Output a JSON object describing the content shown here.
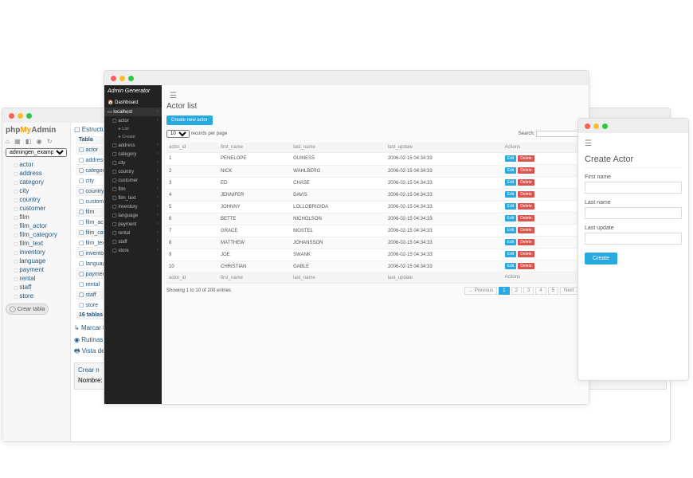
{
  "pma": {
    "logo_parts": [
      "php",
      "My",
      "Admin"
    ],
    "db_select": "admingen_example",
    "tree": [
      "actor",
      "address",
      "category",
      "city",
      "country",
      "customer",
      "film",
      "film_actor",
      "film_category",
      "film_text",
      "inventory",
      "language",
      "payment",
      "rental",
      "staff",
      "store"
    ],
    "crear_tabla": "Crear tabla",
    "tabs": "▢ Estructura",
    "col_heading": "Tabla",
    "table_rows": [
      "actor",
      "address",
      "category",
      "city",
      "country",
      "customer",
      "film",
      "film_actor",
      "film_category",
      "film_text",
      "inventory",
      "language",
      "payment",
      "rental",
      "staff",
      "store"
    ],
    "totals": "16 tablas",
    "marcar": "Marcar t",
    "rutinas": "Rutinas",
    "vista": "Vista de impr",
    "crear_n": "Crear n",
    "nombre": "Nombre:"
  },
  "ag": {
    "brand": "Admin Generator",
    "dashboard": "Dashboard",
    "host": "localhost",
    "menu": [
      "actor",
      "address",
      "category",
      "city",
      "country",
      "customer",
      "film",
      "film_text",
      "inventory",
      "language",
      "payment",
      "rental",
      "staff",
      "store"
    ],
    "submenu": [
      "List",
      "Create"
    ],
    "title": "Actor list",
    "create_new": "Create new actor",
    "per_page_value": "10",
    "per_page_label": "records per page",
    "search_label": "Search:",
    "columns": [
      "actor_id",
      "first_name",
      "last_name",
      "last_update",
      "Actions"
    ],
    "rows": [
      {
        "id": "1",
        "fn": "PENELOPE",
        "ln": "GUINESS",
        "lu": "2006-02-15 04:34:33"
      },
      {
        "id": "2",
        "fn": "NICK",
        "ln": "WAHLBERG",
        "lu": "2006-02-15 04:34:33"
      },
      {
        "id": "3",
        "fn": "ED",
        "ln": "CHASE",
        "lu": "2006-02-15 04:34:33"
      },
      {
        "id": "4",
        "fn": "JENNIFER",
        "ln": "DAVIS",
        "lu": "2006-02-15 04:34:33"
      },
      {
        "id": "5",
        "fn": "JOHNNY",
        "ln": "LOLLOBRIGIDA",
        "lu": "2006-02-15 04:34:33"
      },
      {
        "id": "6",
        "fn": "BETTE",
        "ln": "NICHOLSON",
        "lu": "2006-02-15 04:34:33"
      },
      {
        "id": "7",
        "fn": "GRACE",
        "ln": "MOSTEL",
        "lu": "2006-02-15 04:34:33"
      },
      {
        "id": "8",
        "fn": "MATTHEW",
        "ln": "JOHANSSON",
        "lu": "2006-02-15 04:34:33"
      },
      {
        "id": "9",
        "fn": "JOE",
        "ln": "SWANK",
        "lu": "2006-02-15 04:34:33"
      },
      {
        "id": "10",
        "fn": "CHRISTIAN",
        "ln": "GABLE",
        "lu": "2006-02-15 04:34:33"
      }
    ],
    "edit_label": "Edit",
    "delete_label": "Delete",
    "showing": "Showing 1 to 10 of 200 entries",
    "pages": [
      "← Previous",
      "1",
      "2",
      "3",
      "4",
      "5",
      "Next →"
    ],
    "page_current": "1"
  },
  "ca": {
    "title": "Create Actor",
    "first_name": "First name",
    "last_name": "Last name",
    "last_update": "Last update",
    "create": "Create"
  }
}
